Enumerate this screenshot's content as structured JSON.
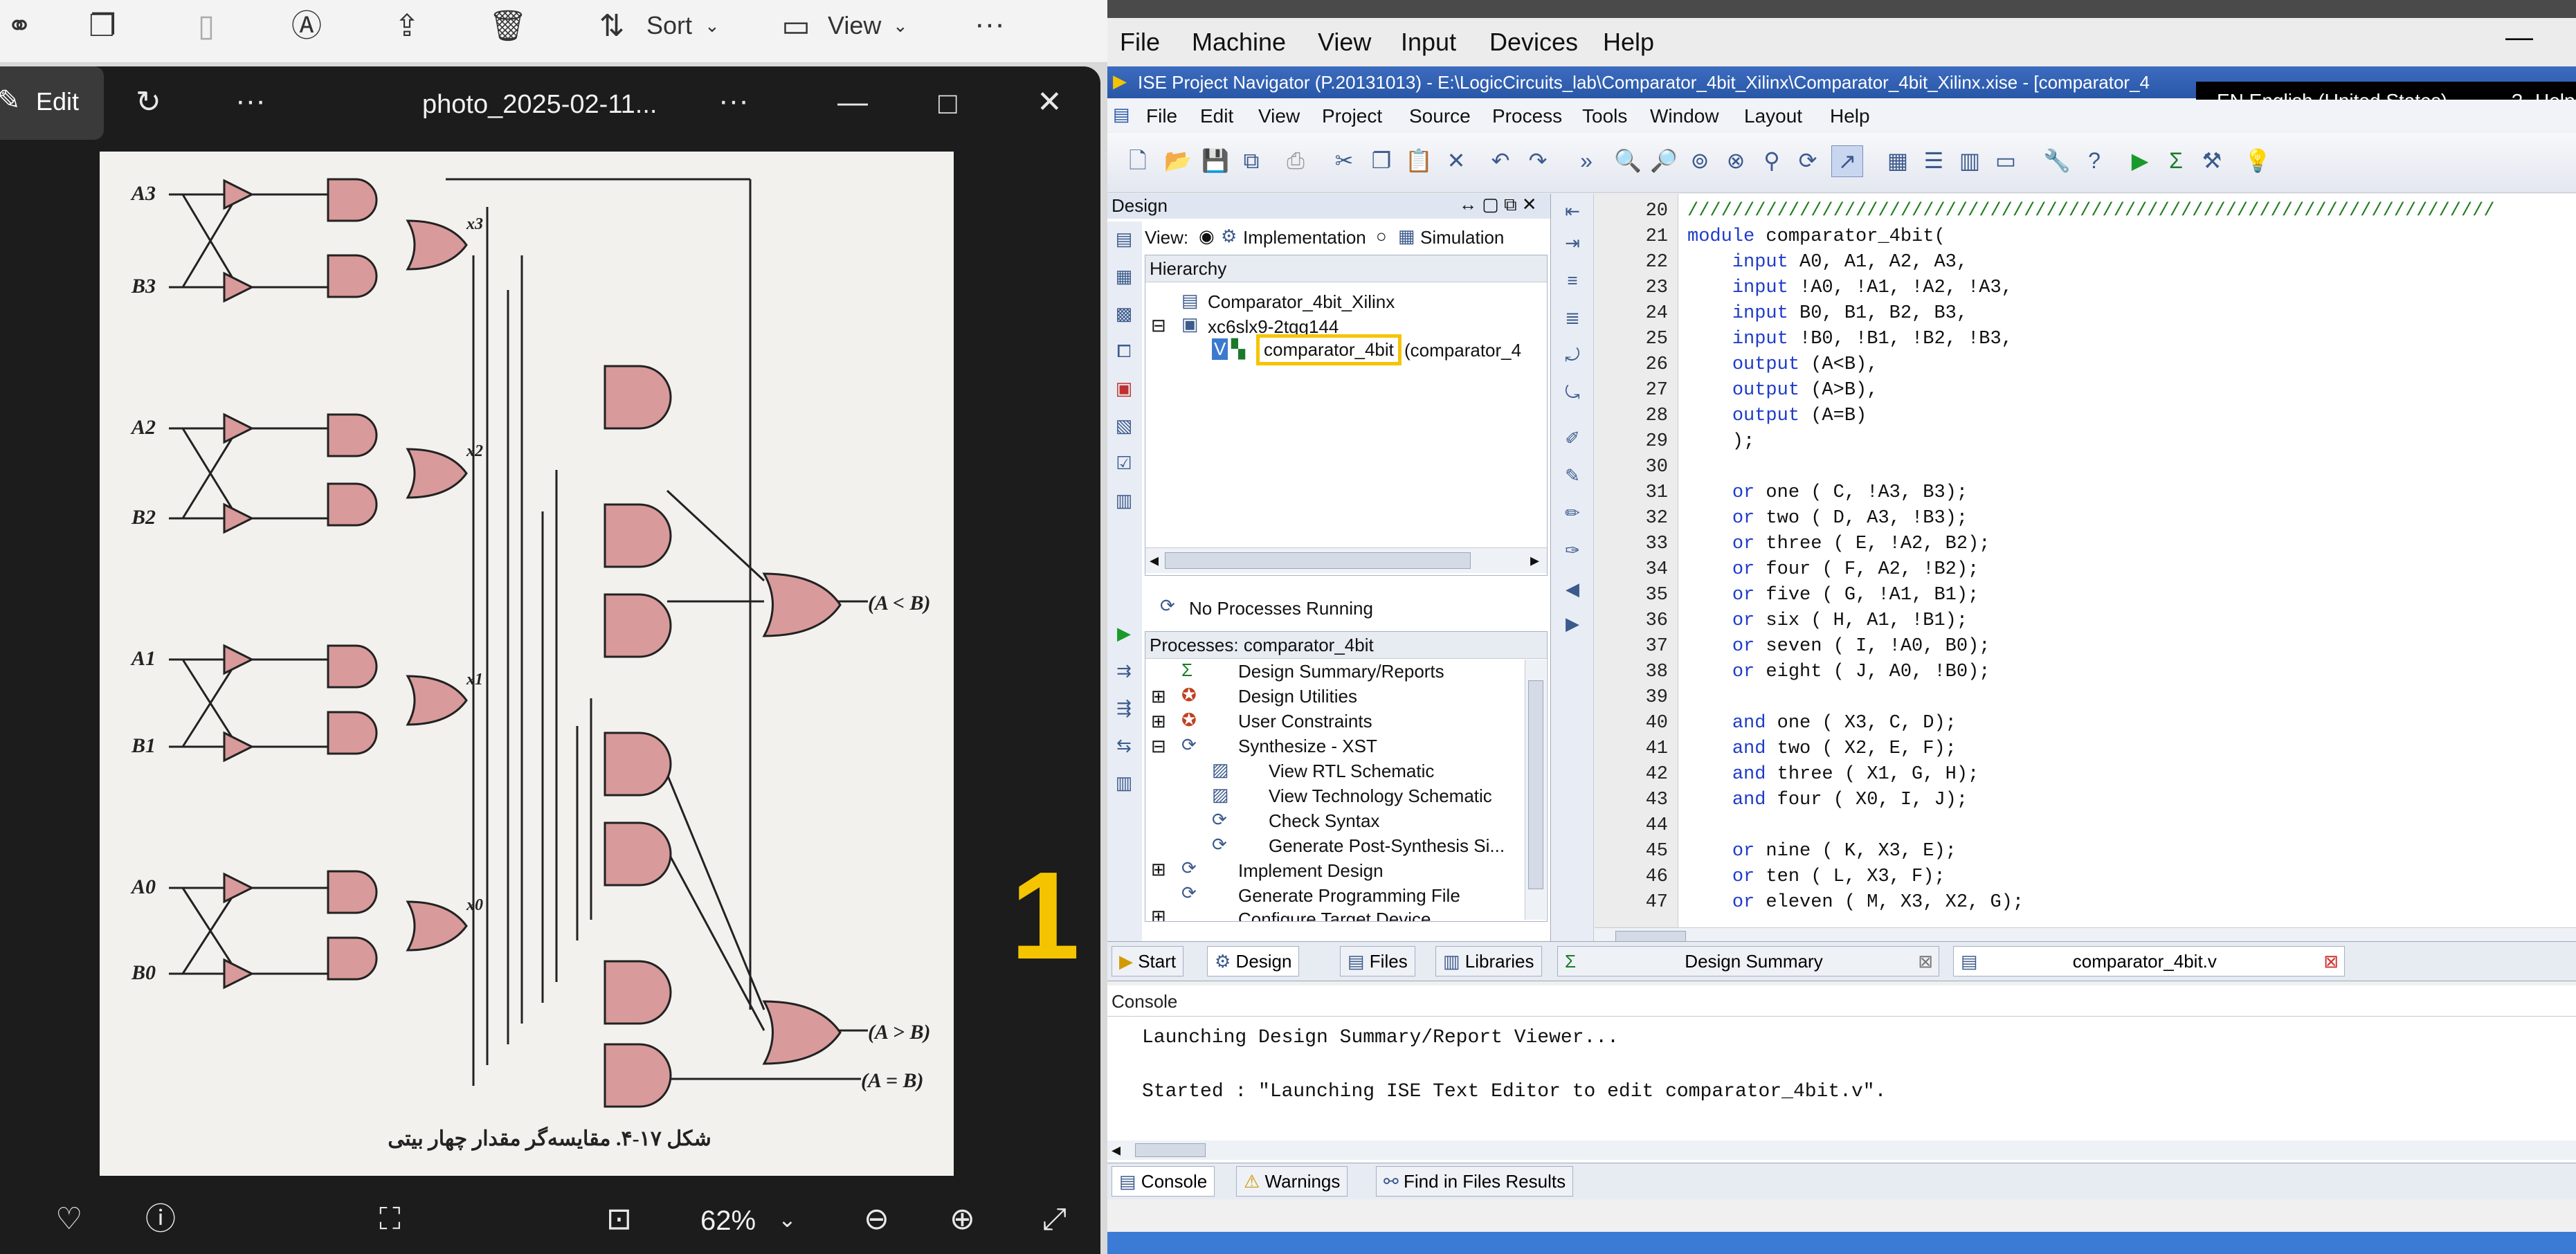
{
  "explorer_toolbar": {
    "sort_label": "Sort",
    "view_label": "View",
    "more_label": "···"
  },
  "photo_viewer": {
    "edit_label": "Edit",
    "more_label": "···",
    "title": "photo_2025-02-11...",
    "zoom": "62%",
    "overlay_number": "1",
    "schematic": {
      "inputs": [
        "A3",
        "B3",
        "A2",
        "B2",
        "A1",
        "B1",
        "A0",
        "B0"
      ],
      "xnor_outputs": [
        "x3",
        "x2",
        "x1",
        "x0"
      ],
      "outputs": [
        "(A < B)",
        "(A > B)",
        "(A = B)"
      ],
      "caption": "شکل ۱۷-۴. مقایسه‌گر مقدار چهار بیتی"
    }
  },
  "vm": {
    "menu": [
      "File",
      "Machine",
      "View",
      "Input",
      "Devices",
      "Help"
    ],
    "ise_title": "ISE Project Navigator (P.20131013) - E:\\LogicCircuits_lab\\Comparator_4bit_Xilinx\\Comparator_4bit_Xilinx.xise - [comparator_4",
    "language": "EN English (United States)",
    "help_label": "Help",
    "ise_menu": [
      "File",
      "Edit",
      "View",
      "Project",
      "Source",
      "Process",
      "Tools",
      "Window",
      "Layout",
      "Help"
    ],
    "design_panel": {
      "title": "Design",
      "view_label": "View:",
      "implementation_label": "Implementation",
      "simulation_label": "Simulation",
      "hierarchy_label": "Hierarchy",
      "tree": [
        "Comparator_4bit_Xilinx",
        "xc6slx9-2tqg144",
        "comparator_4bit",
        "(comparator_4"
      ],
      "no_processes": "No Processes Running",
      "processes_header": "Processes: comparator_4bit",
      "processes": [
        "Design Summary/Reports",
        "Design Utilities",
        "User Constraints",
        "Synthesize - XST",
        "View RTL Schematic",
        "View Technology Schematic",
        "Check Syntax",
        "Generate Post-Synthesis Si...",
        "Implement Design",
        "Generate Programming File",
        "Configure Target Device"
      ]
    },
    "left_tabs": [
      "Start",
      "Design",
      "Files",
      "Libraries"
    ],
    "editor_tabs": [
      "Design Summary",
      "comparator_4bit.v"
    ],
    "code_lines": [
      {
        "n": "20",
        "code": "////////////////////////////////////////////////////////////////////////"
      },
      {
        "n": "21",
        "code": "module comparator_4bit("
      },
      {
        "n": "22",
        "code": "    input A0, A1, A2, A3,"
      },
      {
        "n": "23",
        "code": "    input !A0, !A1, !A2, !A3,"
      },
      {
        "n": "24",
        "code": "    input B0, B1, B2, B3,"
      },
      {
        "n": "25",
        "code": "    input !B0, !B1, !B2, !B3,"
      },
      {
        "n": "26",
        "code": "    output (A<B),"
      },
      {
        "n": "27",
        "code": "    output (A>B),"
      },
      {
        "n": "28",
        "code": "    output (A=B)"
      },
      {
        "n": "29",
        "code": "    );"
      },
      {
        "n": "30",
        "code": ""
      },
      {
        "n": "31",
        "code": "    or one ( C, !A3, B3);"
      },
      {
        "n": "32",
        "code": "    or two ( D, A3, !B3);"
      },
      {
        "n": "33",
        "code": "    or three ( E, !A2, B2);"
      },
      {
        "n": "34",
        "code": "    or four ( F, A2, !B2);"
      },
      {
        "n": "35",
        "code": "    or five ( G, !A1, B1);"
      },
      {
        "n": "36",
        "code": "    or six ( H, A1, !B1);"
      },
      {
        "n": "37",
        "code": "    or seven ( I, !A0, B0);"
      },
      {
        "n": "38",
        "code": "    or eight ( J, A0, !B0);"
      },
      {
        "n": "39",
        "code": ""
      },
      {
        "n": "40",
        "code": "    and one ( X3, C, D);"
      },
      {
        "n": "41",
        "code": "    and two ( X2, E, F);"
      },
      {
        "n": "42",
        "code": "    and three ( X1, G, H);"
      },
      {
        "n": "43",
        "code": "    and four ( X0, I, J);"
      },
      {
        "n": "44",
        "code": ""
      },
      {
        "n": "45",
        "code": "    or nine ( K, X3, E);"
      },
      {
        "n": "46",
        "code": "    or ten ( L, X3, F);"
      },
      {
        "n": "47",
        "code": "    or eleven ( M, X3, X2, G);"
      }
    ],
    "console": {
      "title": "Console",
      "lines": [
        "Launching Design Summary/Report Viewer...",
        "Started : \"Launching ISE Text Editor to edit comparator_4bit.v\"."
      ]
    },
    "bottom_tabs": [
      "Console",
      "Warnings",
      "Find in Files Results"
    ],
    "colors": {
      "highlight_box": "#f5c400",
      "accent": "#2857a7"
    }
  }
}
